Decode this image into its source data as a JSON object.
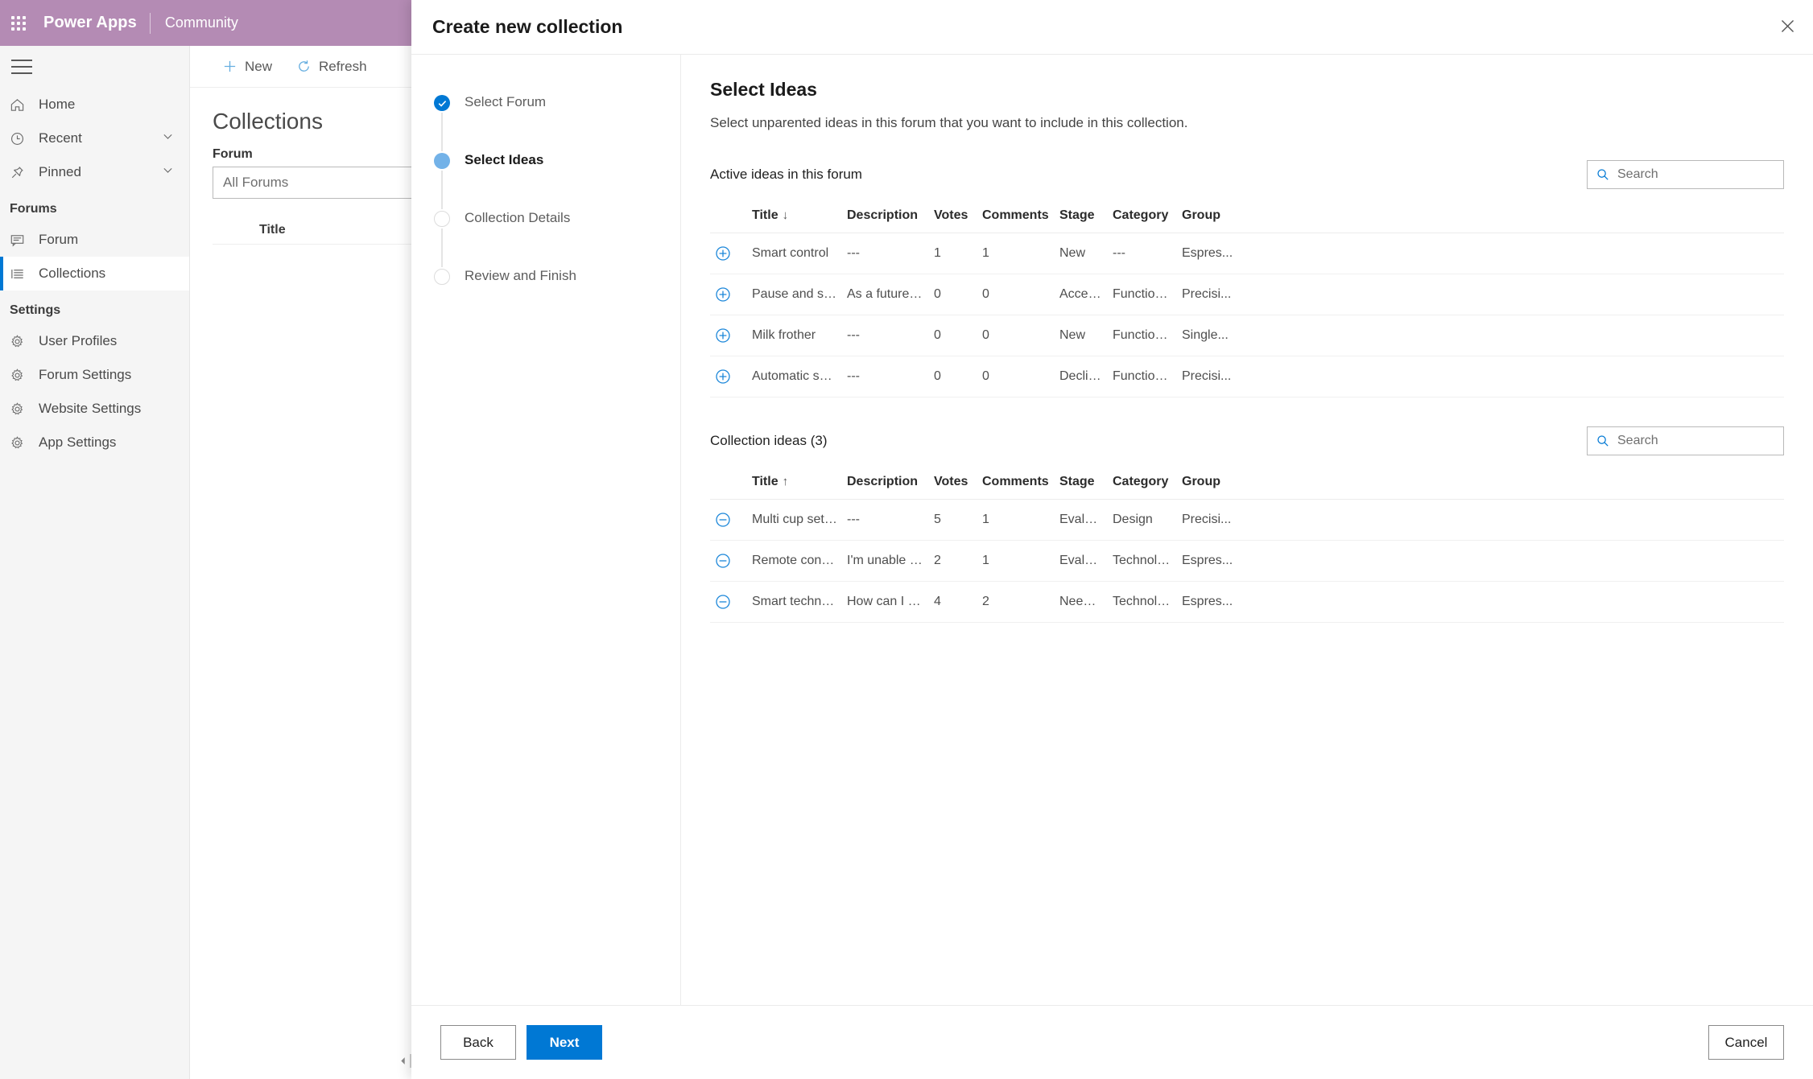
{
  "suite": {
    "waffle_label": "app-launcher",
    "brand": "Power Apps",
    "app_name": "Community",
    "brand_color": "#b48bb4"
  },
  "sidebar": {
    "items": [
      {
        "label": "Home",
        "icon": "home-icon",
        "chevron": false,
        "selected": false
      },
      {
        "label": "Recent",
        "icon": "clock-icon",
        "chevron": true,
        "selected": false
      },
      {
        "label": "Pinned",
        "icon": "pin-icon",
        "chevron": true,
        "selected": false
      }
    ],
    "groups": [
      {
        "title": "Forums",
        "items": [
          {
            "label": "Forum",
            "icon": "forum-icon",
            "selected": false
          },
          {
            "label": "Collections",
            "icon": "collections-icon",
            "selected": true
          }
        ]
      },
      {
        "title": "Settings",
        "items": [
          {
            "label": "User Profiles",
            "icon": "gear-icon",
            "selected": false
          },
          {
            "label": "Forum Settings",
            "icon": "gear-icon",
            "selected": false
          },
          {
            "label": "Website Settings",
            "icon": "gear-icon",
            "selected": false
          },
          {
            "label": "App Settings",
            "icon": "gear-icon",
            "selected": false
          }
        ]
      }
    ]
  },
  "background_page": {
    "commands": [
      {
        "label": "New",
        "icon": "plus-icon"
      },
      {
        "label": "Refresh",
        "icon": "refresh-icon"
      }
    ],
    "title": "Collections",
    "forum_filter_label": "Forum",
    "forum_filter_value": "All Forums",
    "table_header": "Title"
  },
  "dialog": {
    "title": "Create new collection",
    "close_icon": "close-icon",
    "steps": [
      {
        "label": "Select Forum",
        "state": "done"
      },
      {
        "label": "Select Ideas",
        "state": "current"
      },
      {
        "label": "Collection Details",
        "state": "todo"
      },
      {
        "label": "Review and Finish",
        "state": "todo"
      }
    ],
    "pane": {
      "title": "Select Ideas",
      "subtitle": "Select unparented ideas in this forum that you want to include in this collection."
    },
    "active_section": {
      "heading": "Active ideas in this forum",
      "search_placeholder": "Search",
      "search_value": "",
      "columns": [
        "Title",
        "Description",
        "Votes",
        "Comments",
        "Stage",
        "Category",
        "Group"
      ],
      "sort_column": "Title",
      "sort_arrow": "↓",
      "row_action_icon": "add-circle-icon",
      "rows": [
        {
          "title": "Smart control",
          "description": "---",
          "votes": "1",
          "comments": "1",
          "stage": "New",
          "category": "---",
          "group": "Espres..."
        },
        {
          "title": "Pause and serve",
          "description": "As a future fea...",
          "votes": "0",
          "comments": "0",
          "stage": "Accep...",
          "category": "Functional...",
          "group": "Precisi..."
        },
        {
          "title": "Milk frother",
          "description": "---",
          "votes": "0",
          "comments": "0",
          "stage": "New",
          "category": "Functional...",
          "group": "Single..."
        },
        {
          "title": "Automatic shu...",
          "description": "---",
          "votes": "0",
          "comments": "0",
          "stage": "Declin...",
          "category": "Functional...",
          "group": "Precisi..."
        }
      ]
    },
    "collection_section": {
      "heading": "Collection ideas (3)",
      "search_placeholder": "Search",
      "search_value": "",
      "columns": [
        "Title",
        "Description",
        "Votes",
        "Comments",
        "Stage",
        "Category",
        "Group"
      ],
      "sort_column": "Title",
      "sort_arrow": "↑",
      "row_action_icon": "remove-circle-icon",
      "rows": [
        {
          "title": "Multi cup setti...",
          "description": "---",
          "votes": "5",
          "comments": "1",
          "stage": "Evalua...",
          "category": "Design",
          "group": "Precisi..."
        },
        {
          "title": "Remote control",
          "description": "I'm unable to ...",
          "votes": "2",
          "comments": "1",
          "stage": "Evalua...",
          "category": "Technology",
          "group": "Espres..."
        },
        {
          "title": "Smart technol...",
          "description": "How can I bre...",
          "votes": "4",
          "comments": "2",
          "stage": "Needs...",
          "category": "Technology",
          "group": "Espres..."
        }
      ]
    },
    "footer": {
      "back_label": "Back",
      "next_label": "Next",
      "cancel_label": "Cancel",
      "primary_color": "#0078d4"
    }
  }
}
